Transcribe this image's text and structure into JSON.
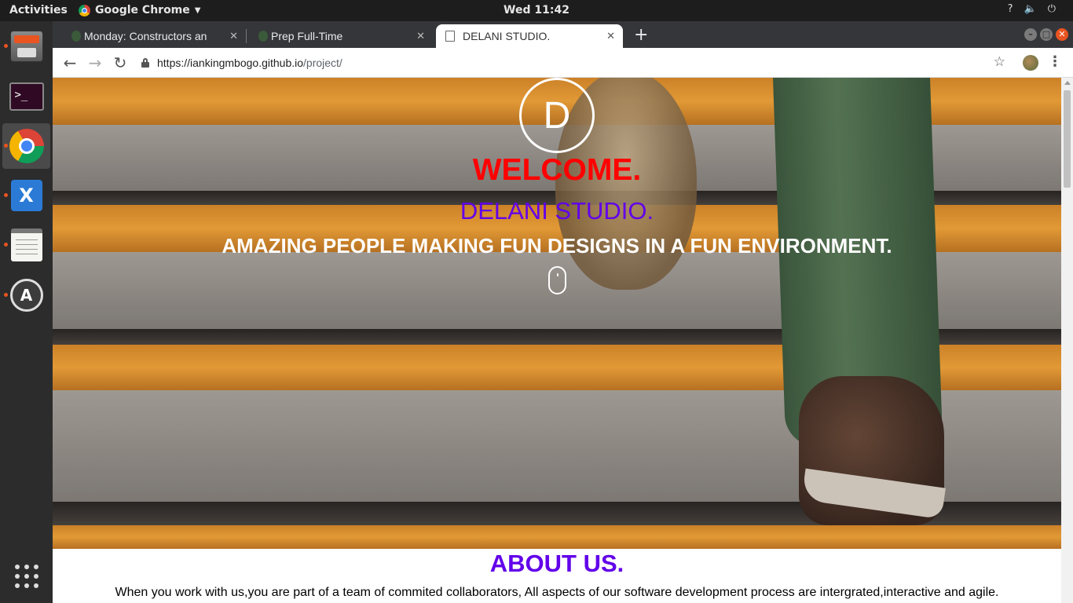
{
  "topbar": {
    "activities": "Activities",
    "app_name": "Google Chrome",
    "clock": "Wed 11:42",
    "tray": [
      "?",
      "🔈",
      "⏻"
    ]
  },
  "dock": {
    "items": [
      "files",
      "terminal",
      "chrome",
      "vscode",
      "text-editor",
      "software-updater"
    ],
    "terminal_glyph": ">_",
    "vscode_glyph": "X",
    "updater_glyph": "A"
  },
  "browser": {
    "tabs": [
      {
        "title": "Monday: Constructors an",
        "active": false
      },
      {
        "title": "Prep Full-Time",
        "active": false
      },
      {
        "title": "DELANI STUDIO.",
        "active": true
      }
    ],
    "new_tab": "+",
    "url_host": "https://iankingmbogo.github.io",
    "url_path": "/project/"
  },
  "page": {
    "logo_letter": "D",
    "welcome": "WELCOME.",
    "studio": "DELANI STUDIO.",
    "tagline": "AMAZING PEOPLE MAKING FUN DESIGNS IN A FUN ENVIRONMENT.",
    "about_title": "ABOUT US.",
    "about_text": "When you work with us,you are part of a team of commited collaborators, All aspects of our software development process are intergrated,interactive and agile."
  },
  "colors": {
    "welcome": "#ff0000",
    "studio": "#6200ea",
    "about_title": "#6200ea",
    "ubuntu_accent": "#e95420"
  }
}
